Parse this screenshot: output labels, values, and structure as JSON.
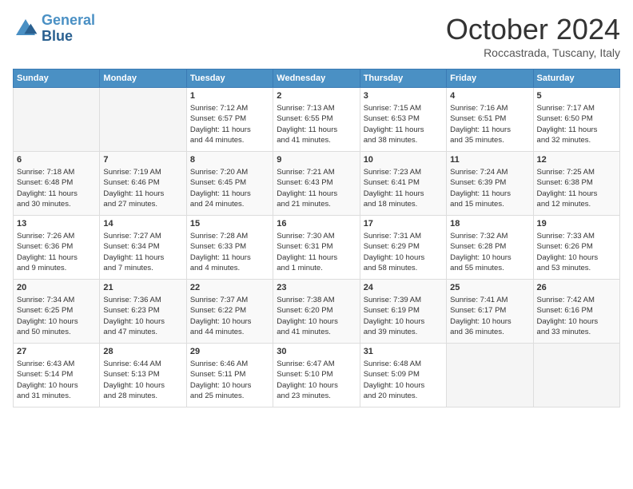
{
  "logo": {
    "line1": "General",
    "line2": "Blue"
  },
  "title": "October 2024",
  "subtitle": "Roccastrada, Tuscany, Italy",
  "days_of_week": [
    "Sunday",
    "Monday",
    "Tuesday",
    "Wednesday",
    "Thursday",
    "Friday",
    "Saturday"
  ],
  "weeks": [
    [
      {
        "day": "",
        "info": ""
      },
      {
        "day": "",
        "info": ""
      },
      {
        "day": "1",
        "info": "Sunrise: 7:12 AM\nSunset: 6:57 PM\nDaylight: 11 hours\nand 44 minutes."
      },
      {
        "day": "2",
        "info": "Sunrise: 7:13 AM\nSunset: 6:55 PM\nDaylight: 11 hours\nand 41 minutes."
      },
      {
        "day": "3",
        "info": "Sunrise: 7:15 AM\nSunset: 6:53 PM\nDaylight: 11 hours\nand 38 minutes."
      },
      {
        "day": "4",
        "info": "Sunrise: 7:16 AM\nSunset: 6:51 PM\nDaylight: 11 hours\nand 35 minutes."
      },
      {
        "day": "5",
        "info": "Sunrise: 7:17 AM\nSunset: 6:50 PM\nDaylight: 11 hours\nand 32 minutes."
      }
    ],
    [
      {
        "day": "6",
        "info": "Sunrise: 7:18 AM\nSunset: 6:48 PM\nDaylight: 11 hours\nand 30 minutes."
      },
      {
        "day": "7",
        "info": "Sunrise: 7:19 AM\nSunset: 6:46 PM\nDaylight: 11 hours\nand 27 minutes."
      },
      {
        "day": "8",
        "info": "Sunrise: 7:20 AM\nSunset: 6:45 PM\nDaylight: 11 hours\nand 24 minutes."
      },
      {
        "day": "9",
        "info": "Sunrise: 7:21 AM\nSunset: 6:43 PM\nDaylight: 11 hours\nand 21 minutes."
      },
      {
        "day": "10",
        "info": "Sunrise: 7:23 AM\nSunset: 6:41 PM\nDaylight: 11 hours\nand 18 minutes."
      },
      {
        "day": "11",
        "info": "Sunrise: 7:24 AM\nSunset: 6:39 PM\nDaylight: 11 hours\nand 15 minutes."
      },
      {
        "day": "12",
        "info": "Sunrise: 7:25 AM\nSunset: 6:38 PM\nDaylight: 11 hours\nand 12 minutes."
      }
    ],
    [
      {
        "day": "13",
        "info": "Sunrise: 7:26 AM\nSunset: 6:36 PM\nDaylight: 11 hours\nand 9 minutes."
      },
      {
        "day": "14",
        "info": "Sunrise: 7:27 AM\nSunset: 6:34 PM\nDaylight: 11 hours\nand 7 minutes."
      },
      {
        "day": "15",
        "info": "Sunrise: 7:28 AM\nSunset: 6:33 PM\nDaylight: 11 hours\nand 4 minutes."
      },
      {
        "day": "16",
        "info": "Sunrise: 7:30 AM\nSunset: 6:31 PM\nDaylight: 11 hours\nand 1 minute."
      },
      {
        "day": "17",
        "info": "Sunrise: 7:31 AM\nSunset: 6:29 PM\nDaylight: 10 hours\nand 58 minutes."
      },
      {
        "day": "18",
        "info": "Sunrise: 7:32 AM\nSunset: 6:28 PM\nDaylight: 10 hours\nand 55 minutes."
      },
      {
        "day": "19",
        "info": "Sunrise: 7:33 AM\nSunset: 6:26 PM\nDaylight: 10 hours\nand 53 minutes."
      }
    ],
    [
      {
        "day": "20",
        "info": "Sunrise: 7:34 AM\nSunset: 6:25 PM\nDaylight: 10 hours\nand 50 minutes."
      },
      {
        "day": "21",
        "info": "Sunrise: 7:36 AM\nSunset: 6:23 PM\nDaylight: 10 hours\nand 47 minutes."
      },
      {
        "day": "22",
        "info": "Sunrise: 7:37 AM\nSunset: 6:22 PM\nDaylight: 10 hours\nand 44 minutes."
      },
      {
        "day": "23",
        "info": "Sunrise: 7:38 AM\nSunset: 6:20 PM\nDaylight: 10 hours\nand 41 minutes."
      },
      {
        "day": "24",
        "info": "Sunrise: 7:39 AM\nSunset: 6:19 PM\nDaylight: 10 hours\nand 39 minutes."
      },
      {
        "day": "25",
        "info": "Sunrise: 7:41 AM\nSunset: 6:17 PM\nDaylight: 10 hours\nand 36 minutes."
      },
      {
        "day": "26",
        "info": "Sunrise: 7:42 AM\nSunset: 6:16 PM\nDaylight: 10 hours\nand 33 minutes."
      }
    ],
    [
      {
        "day": "27",
        "info": "Sunrise: 6:43 AM\nSunset: 5:14 PM\nDaylight: 10 hours\nand 31 minutes."
      },
      {
        "day": "28",
        "info": "Sunrise: 6:44 AM\nSunset: 5:13 PM\nDaylight: 10 hours\nand 28 minutes."
      },
      {
        "day": "29",
        "info": "Sunrise: 6:46 AM\nSunset: 5:11 PM\nDaylight: 10 hours\nand 25 minutes."
      },
      {
        "day": "30",
        "info": "Sunrise: 6:47 AM\nSunset: 5:10 PM\nDaylight: 10 hours\nand 23 minutes."
      },
      {
        "day": "31",
        "info": "Sunrise: 6:48 AM\nSunset: 5:09 PM\nDaylight: 10 hours\nand 20 minutes."
      },
      {
        "day": "",
        "info": ""
      },
      {
        "day": "",
        "info": ""
      }
    ]
  ]
}
